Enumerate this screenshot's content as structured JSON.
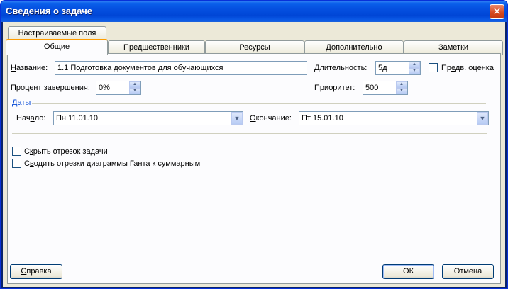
{
  "window": {
    "title": "Сведения о задаче",
    "close_glyph": "✕"
  },
  "tabs": {
    "custom_fields": "Настраиваемые поля",
    "general": "Общие",
    "predecessors": "Предшественники",
    "resources": "Ресурсы",
    "advanced": "Дополнительно",
    "notes": "Заметки"
  },
  "general": {
    "name_label_u": "Н",
    "name_label_rest": "азвание:",
    "name_value": "1.1 Подготовка документов для обучающихся",
    "duration_label_u": "Д",
    "duration_label_rest": "лительность:",
    "duration_value": "5д",
    "estimate_label_pre": "Пр",
    "estimate_label_u": "е",
    "estimate_label_rest": "дв. оценка",
    "estimate_checked": false,
    "percent_label_u": "П",
    "percent_label_rest": "роцент завершения:",
    "percent_value": "0%",
    "priority_label_pre": "Пр",
    "priority_label_u": "и",
    "priority_label_rest": "оритет:",
    "priority_value": "500",
    "dates_group": "Даты",
    "start_label_pre": "Нач",
    "start_label_u": "а",
    "start_label_rest": "ло:",
    "start_value": "Пн 11.01.10",
    "finish_label_u": "О",
    "finish_label_rest": "кончание:",
    "finish_value": "Пт 15.01.10",
    "hide_bar_pre": "С",
    "hide_bar_u": "к",
    "hide_bar_rest": "рыть отрезок задачи",
    "rollup_pre": "С",
    "rollup_u": "в",
    "rollup_rest": "одить отрезки диаграммы Ганта к суммарным"
  },
  "buttons": {
    "help_u": "С",
    "help_rest": "правка",
    "ok": "ОК",
    "cancel": "Отмена"
  },
  "colors": {
    "title_bar": "#0550e0",
    "dialog_bg": "#ece9d8",
    "group_label": "#0046d5"
  }
}
